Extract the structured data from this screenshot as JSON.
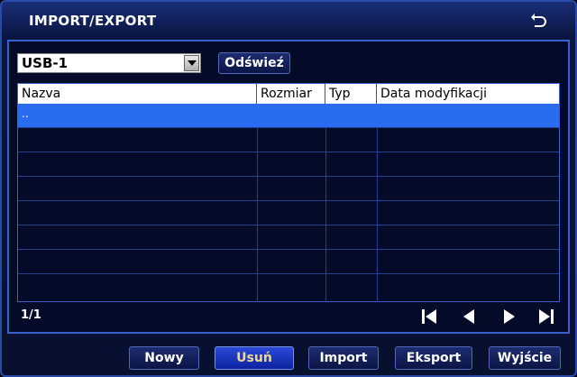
{
  "window": {
    "title": "IMPORT/EXPORT"
  },
  "device": {
    "selected": "USB-1"
  },
  "toolbar": {
    "refresh_label": "Odświeź"
  },
  "table": {
    "columns": [
      "Nazva",
      "Rozmiar",
      "Typ",
      "Data modyfikacji"
    ],
    "rows": [
      {
        "name": "..",
        "size": "",
        "type": "",
        "date": ""
      }
    ],
    "selected_row": 0
  },
  "pager": {
    "page": "1/1"
  },
  "buttons": {
    "new": "Nowy",
    "delete": "Usuń",
    "import": "Import",
    "export": "Eksport",
    "exit": "Wyjście"
  },
  "colors": {
    "selection": "#2a6cf0",
    "dialog_border": "#2a4aa8",
    "active_text": "#f0d890"
  }
}
